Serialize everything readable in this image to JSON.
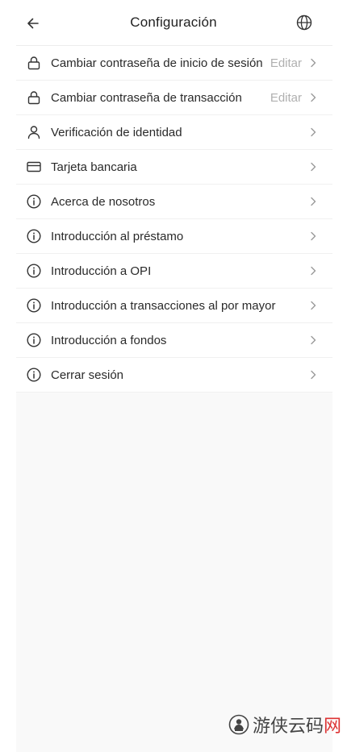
{
  "header": {
    "title": "Configuración",
    "back_icon": "arrow-left-icon",
    "lang_icon": "globe-icon"
  },
  "menu": {
    "items": [
      {
        "label": "Cambiar contraseña de inicio de sesión",
        "icon": "lock-icon",
        "action": "Editar"
      },
      {
        "label": "Cambiar contraseña de transacción",
        "icon": "lock-icon",
        "action": "Editar"
      },
      {
        "label": "Verificación de identidad",
        "icon": "user-icon"
      },
      {
        "label": "Tarjeta bancaria",
        "icon": "card-icon"
      },
      {
        "label": "Acerca de nosotros",
        "icon": "info-icon"
      },
      {
        "label": "Introducción al préstamo",
        "icon": "info-icon"
      },
      {
        "label": "Introducción a OPI",
        "icon": "info-icon"
      },
      {
        "label": "Introducción a transacciones al por mayor",
        "icon": "info-icon"
      },
      {
        "label": "Introducción a fondos",
        "icon": "info-icon"
      },
      {
        "label": "Cerrar sesión",
        "icon": "info-icon"
      }
    ]
  },
  "watermark": {
    "text_main": "游侠云码",
    "text_accent": "网"
  },
  "colors": {
    "text": "#2a2a2a",
    "muted": "#b0b0b0",
    "background": "#f9f9f9"
  }
}
